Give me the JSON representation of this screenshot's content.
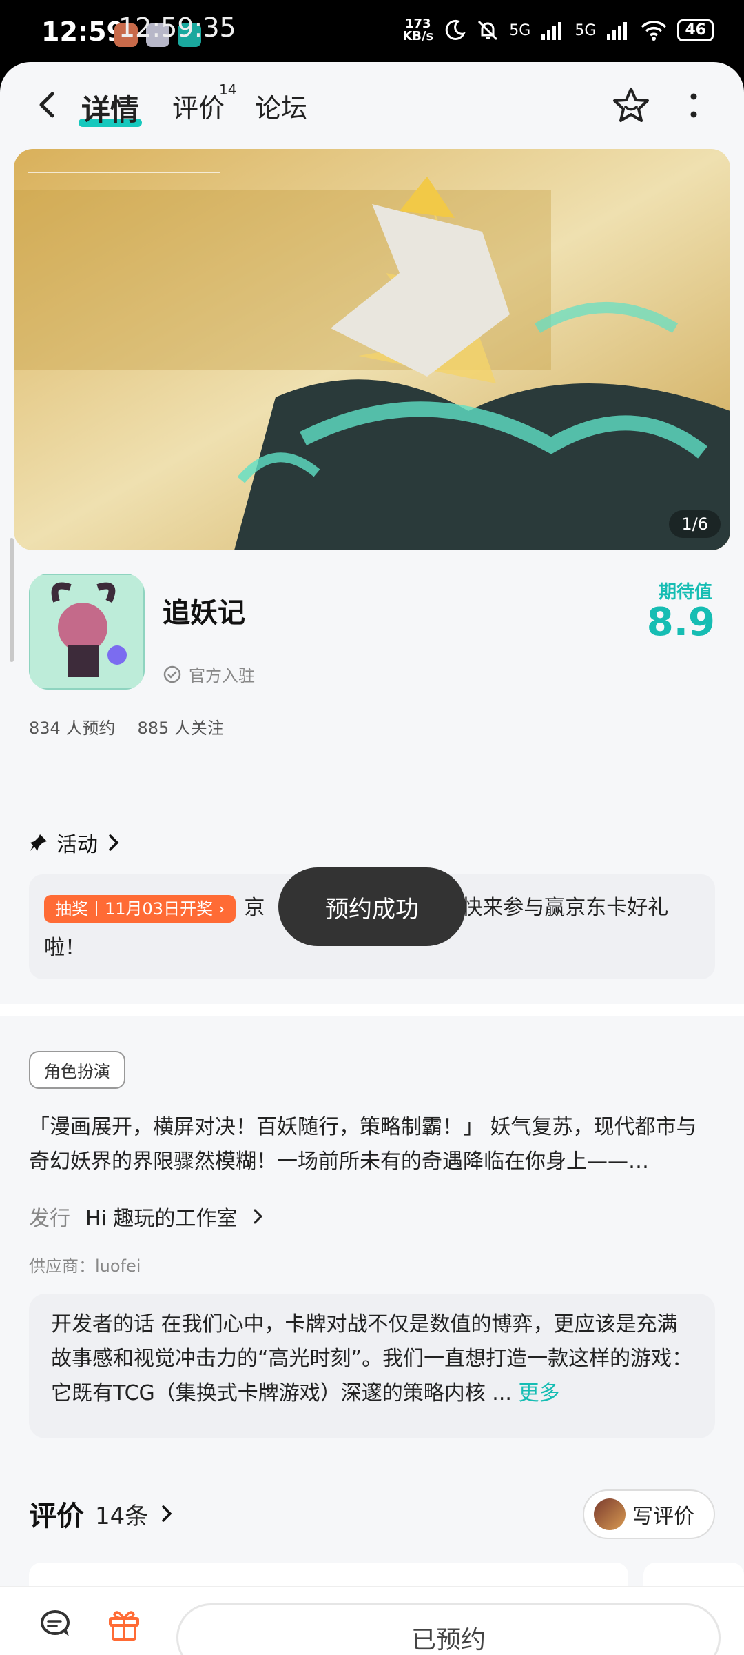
{
  "status_bar": {
    "time": "12:59",
    "overlay_time": "12:59:35",
    "net_speed_value": "173",
    "net_speed_unit": "KB/s",
    "signal_1": "5G",
    "signal_2": "5G",
    "battery": "46"
  },
  "nav": {
    "tab_details": "详情",
    "tab_reviews": "评价",
    "tab_reviews_badge": "14",
    "tab_forum": "论坛"
  },
  "banner": {
    "counter": "1/6"
  },
  "game": {
    "title": "追妖记",
    "official": "官方入驻",
    "rating_label": "期待值",
    "rating_value": "8.9",
    "reservations": "834 人预约",
    "followers": "885 人关注"
  },
  "activity": {
    "heading": "活动",
    "tag": "抽奖丨11月03日开奖",
    "text_before": "京",
    "text_after": "福利】快来参与赢京东卡好礼啦！"
  },
  "toast": {
    "text": "预约成功"
  },
  "info": {
    "tag": "角色扮演",
    "description": "「漫画展开，横屏对决！百妖随行，策略制霸！」 妖气复苏，现代都市与奇幻妖界的界限骤然模糊！一场前所未有的奇遇降临在你身上——…",
    "publisher_label": "发行",
    "publisher_name": "Hi 趣玩的工作室",
    "supplier": "供应商：luofei"
  },
  "developer": {
    "text": "开发者的话  在我们心中，卡牌对战不仅是数值的博弈，更应该是充满故事感和视觉冲击力的“高光时刻”。我们一直想打造一款这样的游戏：它既有TCG（集换式卡牌游戏）深邃的策略内核 ...",
    "more": "更多"
  },
  "reviews": {
    "title": "评价",
    "count": "14条",
    "write_button": "写评价"
  },
  "bottom_bar": {
    "forum_label": "论坛",
    "activity_label": "活动",
    "reserved_button": "已预约"
  },
  "colors": {
    "accent_teal": "#16bdb3",
    "accent_orange": "#ff6b35"
  }
}
